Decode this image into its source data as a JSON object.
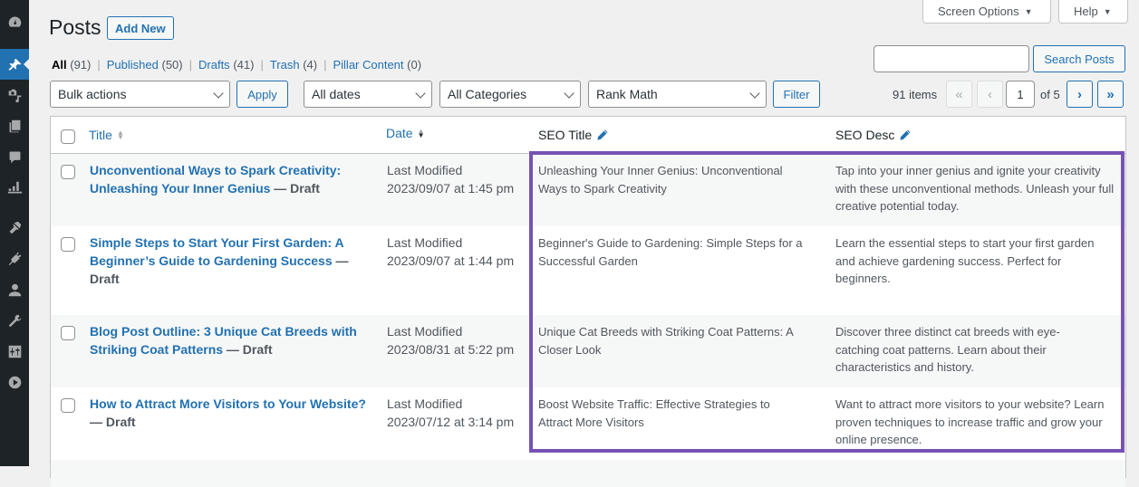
{
  "sidebar": {
    "items": [
      {
        "name": "dashboard",
        "icon": "dashboard-icon"
      },
      {
        "name": "posts",
        "icon": "pushpin-icon",
        "current": true
      },
      {
        "name": "media",
        "icon": "media-icon"
      },
      {
        "name": "pages",
        "icon": "pages-icon"
      },
      {
        "name": "comments",
        "icon": "comment-icon"
      },
      {
        "name": "rank-math",
        "icon": "chart-icon"
      },
      {
        "name": "appearance",
        "icon": "paintbrush-icon"
      },
      {
        "name": "plugins",
        "icon": "plugin-icon"
      },
      {
        "name": "users",
        "icon": "user-icon"
      },
      {
        "name": "tools",
        "icon": "wrench-icon"
      },
      {
        "name": "settings",
        "icon": "sliders-icon"
      },
      {
        "name": "media-player",
        "icon": "play-icon"
      }
    ]
  },
  "header": {
    "screen_options": "Screen Options",
    "help": "Help",
    "title": "Posts",
    "add_new": "Add New"
  },
  "views": [
    {
      "label": "All",
      "count": "(91)",
      "current": true
    },
    {
      "label": "Published",
      "count": "(50)"
    },
    {
      "label": "Drafts",
      "count": "(41)"
    },
    {
      "label": "Trash",
      "count": "(4)"
    },
    {
      "label": "Pillar Content",
      "count": "(0)"
    }
  ],
  "search": {
    "value": "",
    "button": "Search Posts"
  },
  "filters": {
    "bulk_actions": "Bulk actions",
    "apply": "Apply",
    "dates": "All dates",
    "categories": "All Categories",
    "seo_filter": "Rank Math",
    "filter": "Filter"
  },
  "pagination": {
    "items": "91 items",
    "first": "«",
    "prev": "‹",
    "current_page": "1",
    "total": "of 5",
    "next": "›",
    "last": "»"
  },
  "table": {
    "columns": {
      "title": "Title",
      "date": "Date",
      "seo_title": "SEO Title",
      "seo_desc": "SEO Desc"
    },
    "rows": [
      {
        "title": "Unconventional Ways to Spark Creativity: Unleashing Your Inner Genius",
        "state": " — Draft",
        "date_label": "Last Modified",
        "date": "2023/09/07 at 1:45 pm",
        "seo_title": "Unleashing Your Inner Genius: Unconventional Ways to Spark Creativity",
        "seo_desc": "Tap into your inner genius and ignite your creativity with these unconventional methods. Unleash your full creative potential today."
      },
      {
        "title": "Simple Steps to Start Your First Garden: A Beginner’s Guide to Gardening Success",
        "state": " — Draft",
        "date_label": "Last Modified",
        "date": "2023/09/07 at 1:44 pm",
        "seo_title": "Beginner's Guide to Gardening: Simple Steps for a Successful Garden",
        "seo_desc": "Learn the essential steps to start your first garden and achieve gardening success. Perfect for beginners."
      },
      {
        "title": "Blog Post Outline: 3 Unique Cat Breeds with Striking Coat Patterns",
        "state": " — Draft",
        "date_label": "Last Modified",
        "date": "2023/08/31 at 5:22 pm",
        "seo_title": "Unique Cat Breeds with Striking Coat Patterns: A Closer Look",
        "seo_desc": "Discover three distinct cat breeds with eye-catching coat patterns. Learn about their characteristics and history."
      },
      {
        "title": "How to Attract More Visitors to Your Website?",
        "state": " — Draft",
        "date_label": "Last Modified",
        "date": "2023/07/12 at 3:14 pm",
        "seo_title": "Boost Website Traffic: Effective Strategies to Attract More Visitors",
        "seo_desc": "Want to attract more visitors to your website? Learn proven techniques to increase traffic and grow your online presence."
      }
    ]
  },
  "colors": {
    "link": "#2271b1",
    "sidebar_bg": "#1d2327",
    "highlight_border": "#7652b4"
  }
}
